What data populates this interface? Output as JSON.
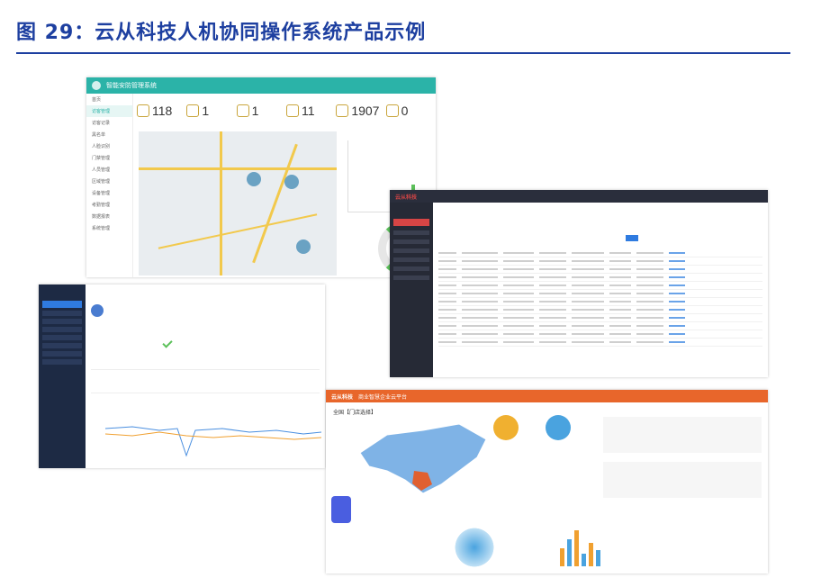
{
  "figure": {
    "title": "图 29：云从科技人机协同操作系统产品示例"
  },
  "screen1": {
    "app_title": "智能安防管理系统",
    "sidebar": [
      "首页",
      "访客管理",
      "访客记录",
      "黑名单",
      "人脸识别",
      "门禁管理",
      "人员管理",
      "区域管理",
      "设备管理",
      "考勤管理",
      "数据报表",
      "系统管理"
    ],
    "stats": [
      {
        "value": "118"
      },
      {
        "value": "1"
      },
      {
        "value": "1"
      },
      {
        "value": "11"
      },
      {
        "value": "1907"
      },
      {
        "value": "0"
      }
    ]
  },
  "screen3": {
    "logo": "云从科技",
    "rows": 12
  },
  "screen4": {
    "logo": "云从科技",
    "app_title": "商业智慧企业云平台",
    "region_label": "全国【门店选择】"
  },
  "colors": {
    "title_blue": "#1d3fa0",
    "teal": "#2bb3a8",
    "navy": "#1d2a44",
    "red": "#d64545",
    "orange": "#e8662b"
  }
}
